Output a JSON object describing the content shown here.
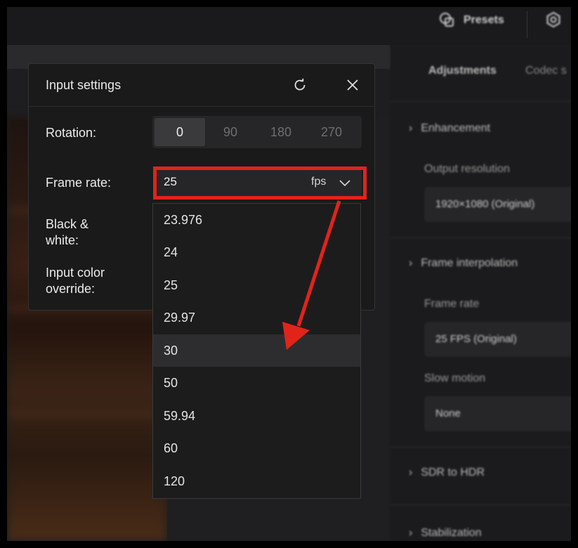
{
  "topbar": {
    "presets_label": "Presets",
    "presets_icon": "presets-icon",
    "settings_icon": "gear-icon"
  },
  "right_panel": {
    "tabs": [
      "Adjustments",
      "Codec s"
    ],
    "sections": {
      "enhancement": "Enhancement",
      "frame_interpolation": "Frame interpolation",
      "sdr_to_hdr": "SDR to HDR",
      "stabilization": "Stabilization"
    },
    "output_resolution_label": "Output resolution",
    "output_resolution_value": "1920×1080 (Original)",
    "frame_rate_label": "Frame rate",
    "frame_rate_value": "25 FPS (Original)",
    "slow_motion_label": "Slow motion",
    "slow_motion_value": "None"
  },
  "dialog": {
    "title": "Input settings",
    "reset_icon": "refresh-icon",
    "close_icon": "close-icon",
    "rotation_label": "Rotation:",
    "rotation_options": [
      "0",
      "90",
      "180",
      "270"
    ],
    "rotation_selected": "0",
    "frame_rate_label": "Frame rate:",
    "frame_rate_value": "25",
    "frame_rate_unit": "fps",
    "bw_label_line1": "Black &",
    "bw_label_line2": "white:",
    "color_label_line1": "Input color",
    "color_label_line2": "override:"
  },
  "dropdown": {
    "options": [
      "23.976",
      "24",
      "25",
      "29.97",
      "30",
      "50",
      "59.94",
      "60",
      "120"
    ],
    "hovered": "30"
  },
  "annotation": {
    "color": "#e2231a"
  }
}
